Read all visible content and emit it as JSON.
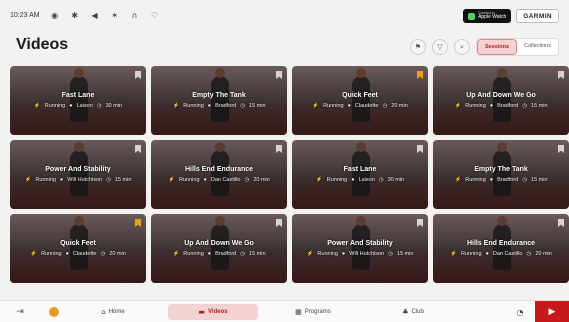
{
  "status": {
    "time": "10:23 AM",
    "icons": [
      {
        "name": "wifi-icon",
        "glyph": "◉"
      },
      {
        "name": "gear-icon",
        "glyph": "✱"
      },
      {
        "name": "speaker-icon",
        "glyph": "◀"
      },
      {
        "name": "bluetooth-icon",
        "glyph": "✶"
      },
      {
        "name": "headphones-icon",
        "glyph": "∩"
      },
      {
        "name": "heart-rate-icon",
        "glyph": "♡"
      }
    ]
  },
  "badges": {
    "watch_small": "Connect to",
    "watch_label": "Apple Watch",
    "garmin_label": "GARMIN"
  },
  "page": {
    "title": "Videos"
  },
  "controls": {
    "bookmark_glyph": "⚑",
    "filter_glyph": "▽",
    "search_glyph": "⌕",
    "sessions_label": "Sessions",
    "collections_label": "Collections"
  },
  "cards": [
    {
      "title": "Fast Lane",
      "category": "Running",
      "trainer": "Laison",
      "duration": "30 min",
      "saved": false
    },
    {
      "title": "Empty The Tank",
      "category": "Running",
      "trainer": "Bradford",
      "duration": "15 min",
      "saved": false
    },
    {
      "title": "Quick Feet",
      "category": "Running",
      "trainer": "Claudette",
      "duration": "20 min",
      "saved": true
    },
    {
      "title": "Up And Down We Go",
      "category": "Running",
      "trainer": "Bradford",
      "duration": "15 min",
      "saved": false
    },
    {
      "title": "Power And Stability",
      "category": "Running",
      "trainer": "Will Hutchison",
      "duration": "15 min",
      "saved": false
    },
    {
      "title": "Hills End Endurance",
      "category": "Running",
      "trainer": "Dan Castillo",
      "duration": "20 min",
      "saved": false
    },
    {
      "title": "Fast Lane",
      "category": "Running",
      "trainer": "Laison",
      "duration": "30 min",
      "saved": false
    },
    {
      "title": "Empty The Tank",
      "category": "Running",
      "trainer": "Bradford",
      "duration": "15 min",
      "saved": false
    },
    {
      "title": "Quick Feet",
      "category": "Running",
      "trainer": "Claudette",
      "duration": "20 min",
      "saved": true
    },
    {
      "title": "Up And Down We Go",
      "category": "Running",
      "trainer": "Bradford",
      "duration": "15 min",
      "saved": false
    },
    {
      "title": "Power And Stability",
      "category": "Running",
      "trainer": "Will Hutchison",
      "duration": "15 min",
      "saved": false
    },
    {
      "title": "Hills End Endurance",
      "category": "Running",
      "trainer": "Dan Castillo",
      "duration": "20 min",
      "saved": false
    }
  ],
  "tabbar": {
    "exit_glyph": "⇥",
    "home_label": "Home",
    "home_glyph": "⌂",
    "videos_label": "Videos",
    "videos_glyph": "▬",
    "programs_label": "Programs",
    "programs_glyph": "▦",
    "club_label": "Club",
    "club_glyph": "♣",
    "timer_glyph": "◔",
    "play_glyph": "▶"
  },
  "colors": {
    "accent": "#c61a1a",
    "accent_soft": "#f2d2d2",
    "saved": "#e6a21a"
  }
}
